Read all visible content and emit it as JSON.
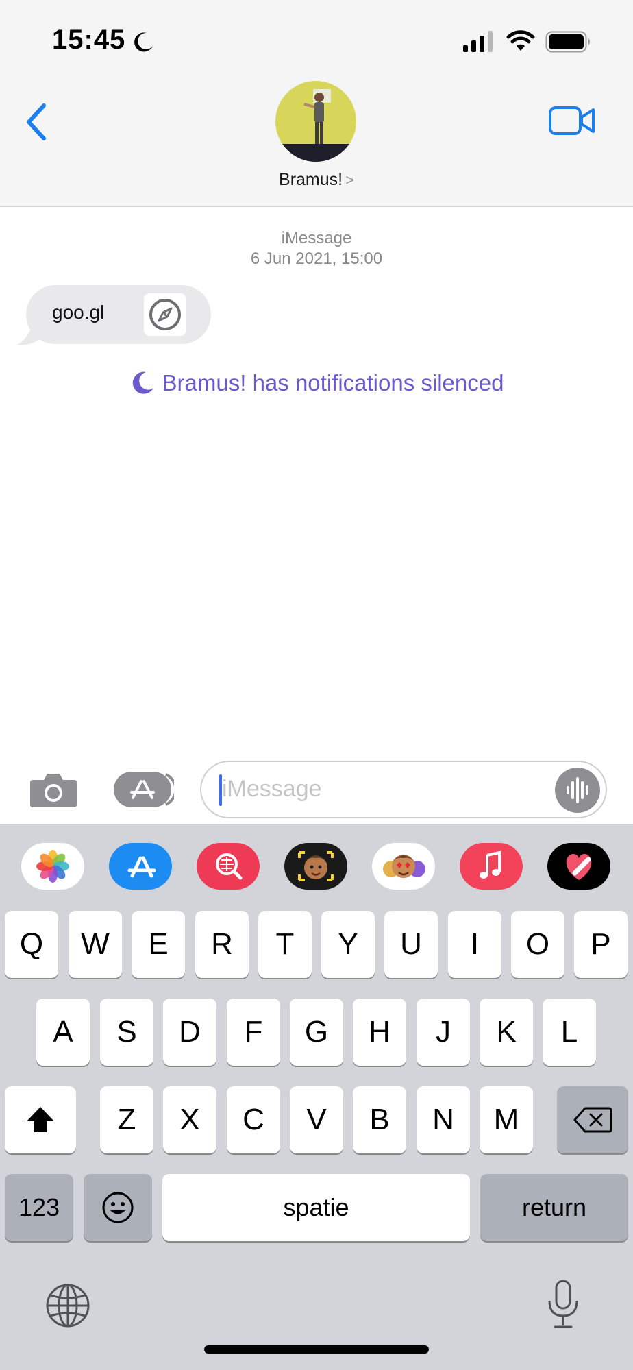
{
  "status_bar": {
    "time": "15:45",
    "focus_icon": "moon-icon",
    "signal_icon": "signal-bars-icon",
    "wifi_icon": "wifi-icon",
    "battery_icon": "battery-icon"
  },
  "header": {
    "back_icon": "chevron-left-icon",
    "contact_name": "Bramus!",
    "contact_chevron": ">",
    "video_icon": "video-camera-icon",
    "accent_color": "#1c7ff0"
  },
  "conversation": {
    "service": "iMessage",
    "timestamp": "6 Jun 2021, 15:00",
    "messages": [
      {
        "text": "goo.gl",
        "link_icon": "compass-icon"
      }
    ],
    "notice": "Bramus! has notifications silenced",
    "notice_color": "#6a5acd"
  },
  "input_bar": {
    "camera_icon": "camera-icon",
    "apps_icon": "app-store-icon",
    "placeholder": "iMessage",
    "audio_icon": "waveform-icon"
  },
  "app_strip": [
    "photos-icon",
    "app-store-icon",
    "images-search-icon",
    "memoji-icon",
    "memoji-stickers-icon",
    "music-icon",
    "digital-touch-icon"
  ],
  "keyboard": {
    "row1": [
      "Q",
      "W",
      "E",
      "R",
      "T",
      "Y",
      "U",
      "I",
      "O",
      "P"
    ],
    "row2": [
      "A",
      "S",
      "D",
      "F",
      "G",
      "H",
      "J",
      "K",
      "L"
    ],
    "row3": [
      "Z",
      "X",
      "C",
      "V",
      "B",
      "N",
      "M"
    ],
    "shift_icon": "shift-icon",
    "delete_icon": "delete-icon",
    "numbers_label": "123",
    "emoji_icon": "emoji-icon",
    "space_label": "spatie",
    "return_label": "return",
    "globe_icon": "globe-icon",
    "mic_icon": "microphone-icon"
  }
}
